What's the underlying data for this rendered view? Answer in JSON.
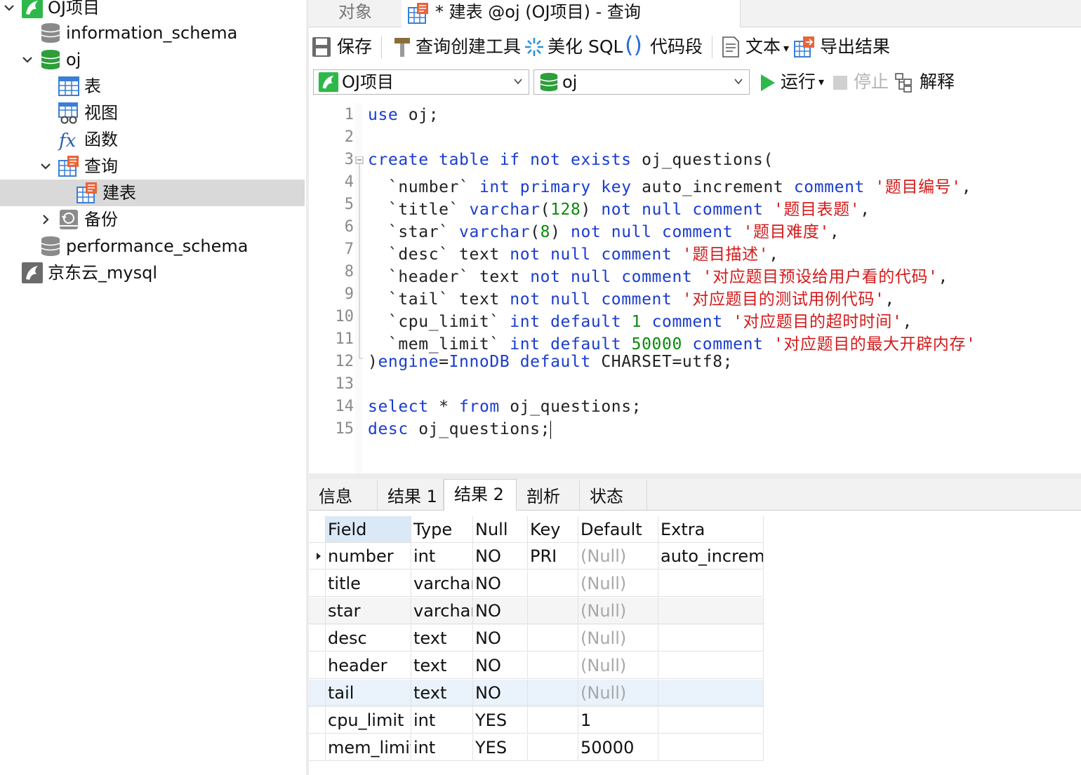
{
  "sidebar": {
    "items": [
      {
        "label": "OJ项目",
        "icon": "mysql-connection-icon",
        "expanded": true
      },
      {
        "label": "information_schema",
        "icon": "database-icon"
      },
      {
        "label": "oj",
        "icon": "database-active-icon",
        "expanded": true
      },
      {
        "label": "表",
        "icon": "table-icon"
      },
      {
        "label": "视图",
        "icon": "view-icon"
      },
      {
        "label": "函数",
        "icon": "function-icon"
      },
      {
        "label": "查询",
        "icon": "query-icon",
        "expanded": true
      },
      {
        "label": "建表",
        "icon": "query-icon",
        "selected": true
      },
      {
        "label": "备份",
        "icon": "backup-icon",
        "expanded": false
      },
      {
        "label": "performance_schema",
        "icon": "database-icon"
      },
      {
        "label": "京东云_mysql",
        "icon": "mysql-connection-inactive-icon"
      }
    ]
  },
  "tabs": {
    "objects": "对象",
    "query": "* 建表 @oj (OJ项目) - 查询"
  },
  "toolbar": {
    "save": "保存",
    "query_builder": "查询创建工具",
    "beautify": "美化 SQL",
    "snippet": "代码段",
    "text": "文本",
    "export": "导出结果"
  },
  "selectors": {
    "connection": "OJ项目",
    "database": "oj",
    "run": "运行",
    "stop": "停止",
    "explain": "解释"
  },
  "editor": {
    "line_numbers": [
      "1",
      "2",
      "3",
      "4",
      "5",
      "6",
      "7",
      "8",
      "9",
      "10",
      "11",
      "12",
      "13",
      "14",
      "15"
    ]
  },
  "result_tabs": [
    "信息",
    "结果 1",
    "结果 2",
    "剖析",
    "状态"
  ],
  "result_active_tab": "结果 2",
  "grid": {
    "columns": [
      "Field",
      "Type",
      "Null",
      "Key",
      "Default",
      "Extra"
    ],
    "rows": [
      [
        "number",
        "int",
        "NO",
        "PRI",
        "(Null)",
        "auto_increment"
      ],
      [
        "title",
        "varchar",
        "NO",
        "",
        "(Null)",
        ""
      ],
      [
        "star",
        "varchar",
        "NO",
        "",
        "(Null)",
        ""
      ],
      [
        "desc",
        "text",
        "NO",
        "",
        "(Null)",
        ""
      ],
      [
        "header",
        "text",
        "NO",
        "",
        "(Null)",
        ""
      ],
      [
        "tail",
        "text",
        "NO",
        "",
        "(Null)",
        ""
      ],
      [
        "cpu_limit",
        "int",
        "YES",
        "",
        "1",
        ""
      ],
      [
        "mem_limit",
        "int",
        "YES",
        "",
        "50000",
        ""
      ]
    ]
  },
  "colors": {
    "keyword": "#1a3ccf",
    "string": "#d31a1a",
    "number": "#0a8a0a",
    "selected_row": "#d9d9d9",
    "highlight_row": "#eaf2fb"
  }
}
